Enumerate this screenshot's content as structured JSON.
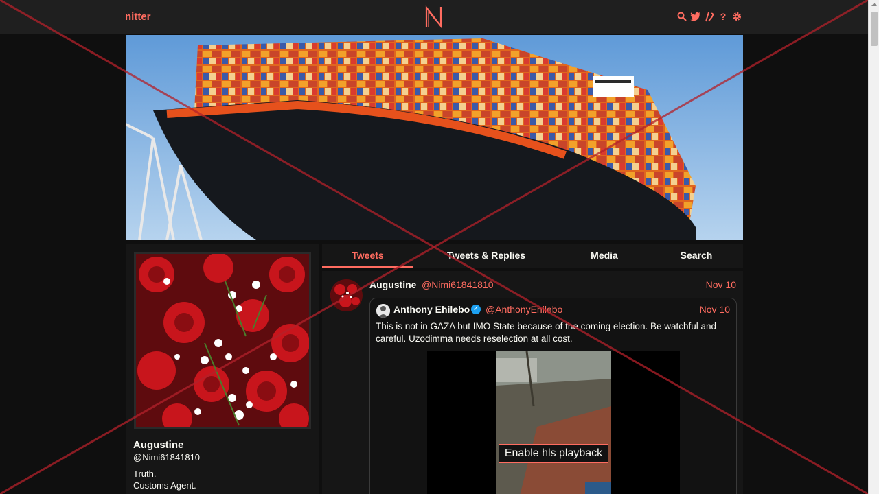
{
  "nav": {
    "brand": "nitter",
    "logo_letter": "N",
    "icons": [
      "search-icon",
      "twitter-icon",
      "rss-icon",
      "help-icon",
      "gear-icon"
    ]
  },
  "banner": {
    "subject": "container-ship"
  },
  "profile": {
    "name": "Augustine",
    "handle": "@Nimi61841810",
    "bio_line1": "Truth.",
    "bio_line2": "Customs Agent."
  },
  "tabs": [
    {
      "label": "Tweets",
      "active": true
    },
    {
      "label": "Tweets & Replies",
      "active": false
    },
    {
      "label": "Media",
      "active": false
    },
    {
      "label": "Search",
      "active": false
    }
  ],
  "tweet": {
    "author": "Augustine",
    "handle": "@Nimi61841810",
    "date": "Nov 10",
    "quote": {
      "author": "Anthony Ehilebo",
      "verified": true,
      "handle": "@AnthonyEhilebo",
      "date": "Nov 10",
      "text": "This is not in GAZA but IMO State because of the coming election. Be watchful and careful. Uzodimma needs reselection at all cost.",
      "video_button": "Enable hls playback"
    }
  },
  "colors": {
    "accent": "#ff6c60",
    "background": "#0f0f0f",
    "panel": "#161616",
    "navbar": "#1f1f1f",
    "verified": "#1da1f2"
  }
}
